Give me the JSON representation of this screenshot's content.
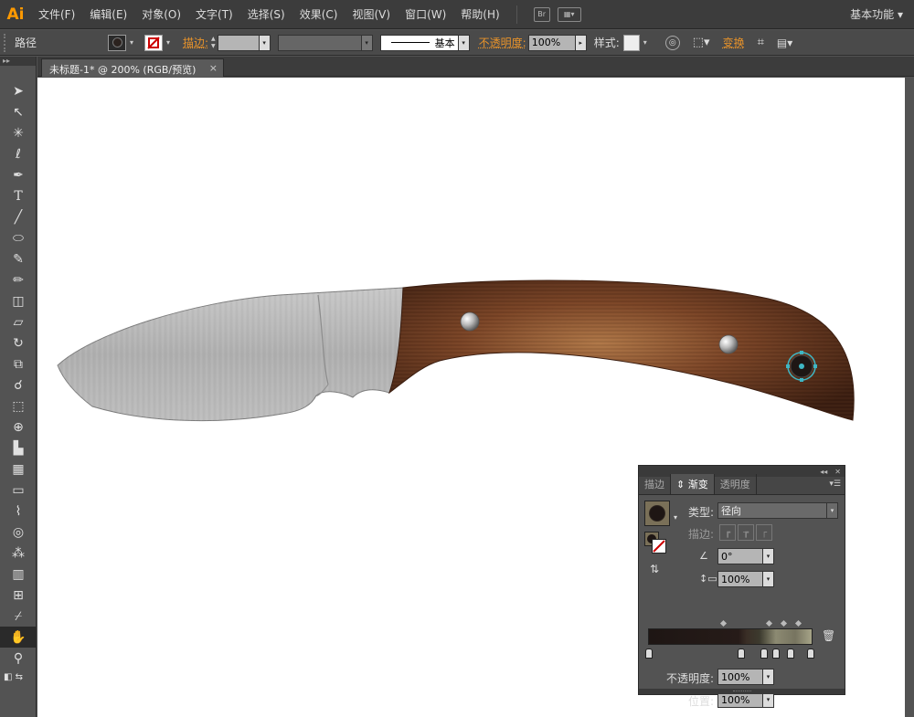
{
  "app": {
    "logo": "Ai",
    "workspace": "基本功能",
    "br_label": "Br"
  },
  "menu": [
    "文件(F)",
    "编辑(E)",
    "对象(O)",
    "文字(T)",
    "选择(S)",
    "效果(C)",
    "视图(V)",
    "窗口(W)",
    "帮助(H)"
  ],
  "options": {
    "object_type": "路径",
    "stroke_label": "描边:",
    "stroke_profile": "基本",
    "opacity_label": "不透明度:",
    "opacity_value": "100%",
    "style_label": "样式:",
    "transform_label": "变换"
  },
  "document": {
    "tab_title": "未标题-1* @ 200% (RGB/预览)",
    "close": "×"
  },
  "tools": [
    "selection-icon",
    "direct-selection-icon",
    "magic-wand-icon",
    "lasso-icon",
    "pen-icon",
    "type-icon",
    "line-icon",
    "ellipse-icon",
    "paintbrush-icon",
    "pencil-icon",
    "blob-brush-icon",
    "eraser-icon",
    "rotate-icon",
    "scale-icon",
    "warp-icon",
    "free-transform-icon",
    "shape-builder-icon",
    "perspective-icon",
    "mesh-icon",
    "gradient-icon",
    "eyedropper-icon",
    "blend-icon",
    "symbol-sprayer-icon",
    "graph-icon",
    "artboard-icon",
    "slice-icon",
    "hand-icon",
    "zoom-icon"
  ],
  "gradient_panel": {
    "tabs": [
      "描边",
      "渐变",
      "透明度"
    ],
    "active_tab": "渐变",
    "type_label": "类型:",
    "type_value": "径向",
    "stroke_label": "描边:",
    "angle_value": "0°",
    "aspect_value": "100%",
    "opacity_label": "不透明度:",
    "opacity_value": "100%",
    "location_label": "位置:",
    "location_value": "100%"
  },
  "colors": {
    "accent": "#e8932a",
    "panel_bg": "#535353",
    "canvas": "#ffffff",
    "handle_wood": "#6b3b1f",
    "blade": "#b9b9b9"
  }
}
